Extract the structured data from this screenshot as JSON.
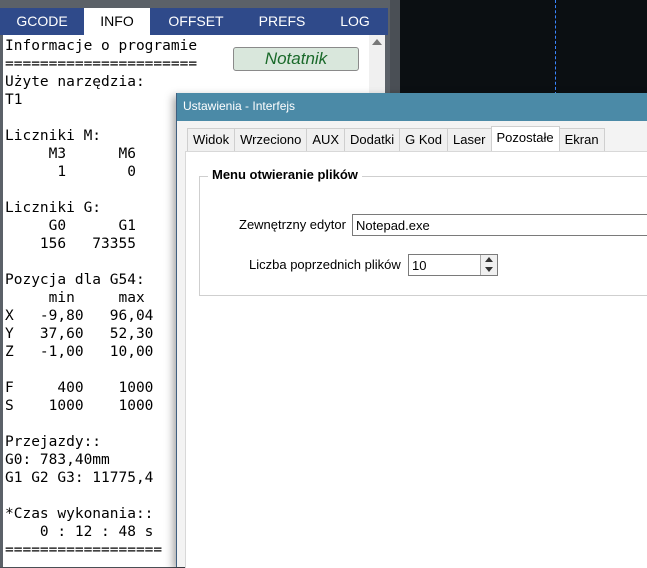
{
  "left_tabs": [
    "GCODE",
    "INFO",
    "OFFSET",
    "PREFS",
    "LOG"
  ],
  "active_tab": "INFO",
  "info_lines": [
    "Informacje o programie",
    "======================",
    "Użyte narzędzia:",
    "T1",
    "",
    "Liczniki M:",
    "     M3      M6",
    "      1       0",
    "",
    "Liczniki G:",
    "     G0      G1",
    "    156   73355",
    "",
    "Pozycja dla G54:",
    "     min     max",
    "X   -9,80   96,04",
    "Y   37,60   52,30",
    "Z   -1,00   10,00",
    "",
    "F     400    1000",
    "S    1000    1000",
    "",
    "Przejazdy::",
    "G0: 783,40mm",
    "G1 G2 G3: 11775,4",
    "",
    "*Czas wykonania::",
    "    0 : 12 : 48 s",
    "=================="
  ],
  "notatnik_label": "Notatnik",
  "settings": {
    "title": "Ustawienia - Interfejs",
    "tabs": [
      "Widok",
      "Wrzeciono",
      "AUX",
      "Dodatki",
      "G Kod",
      "Laser",
      "Pozostałe",
      "Ekran"
    ],
    "active_tab": "Pozostałe",
    "group_title": "Menu otwieranie plików",
    "editor_label": "Zewnętrzny edytor",
    "editor_value": "Notepad.exe",
    "recent_label": "Liczba poprzednich plików",
    "recent_value": "10"
  }
}
